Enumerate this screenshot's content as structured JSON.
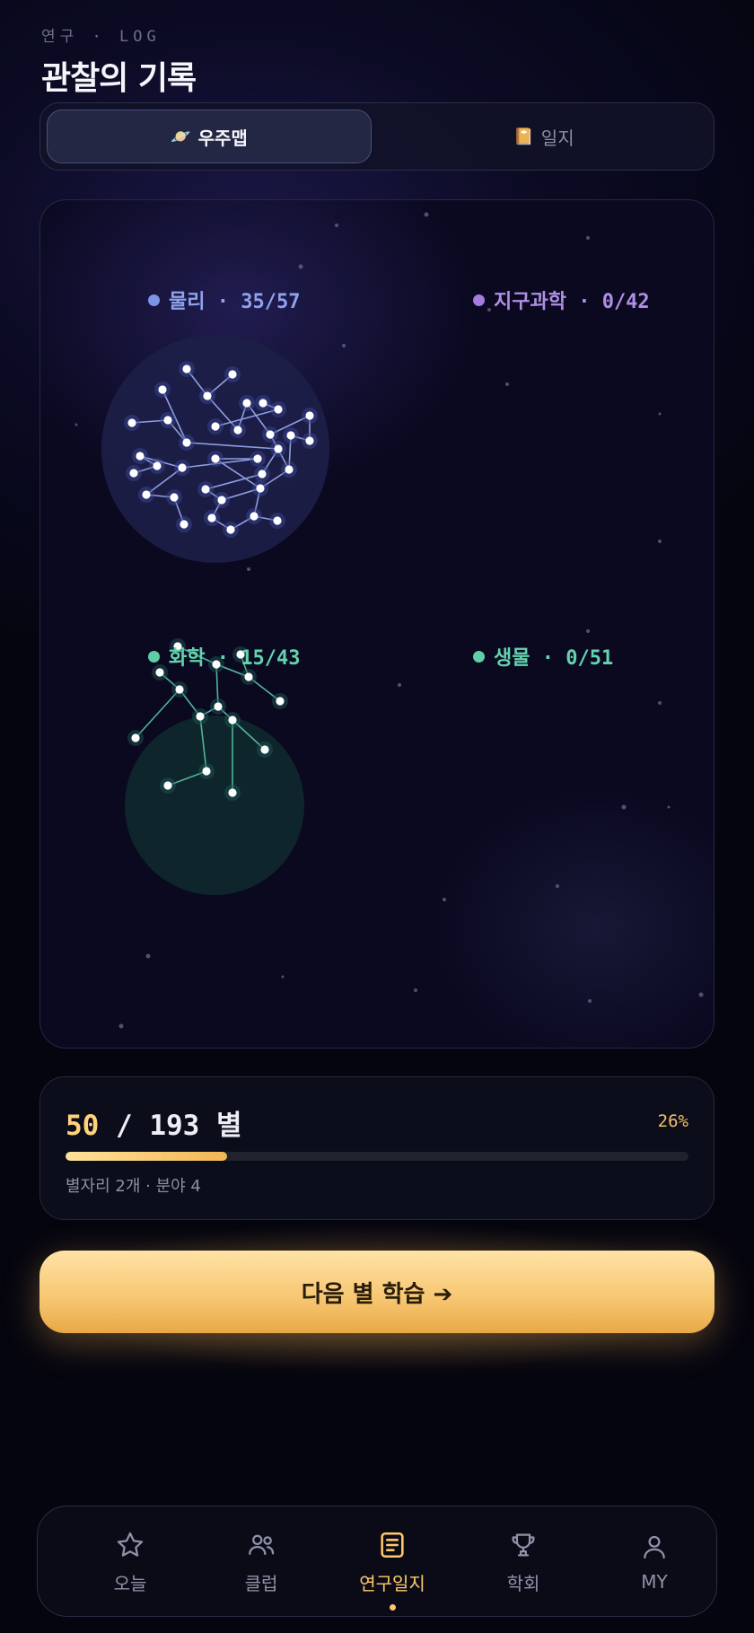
{
  "header": {
    "eyebrow": "연구 · LOG",
    "title": "관찰의 기록"
  },
  "segmented": {
    "tabs": [
      {
        "icon": "ringed-planet-icon",
        "glyph": "🪐",
        "label": "우주맵",
        "active": true
      },
      {
        "icon": "notebook-icon",
        "glyph": "📔",
        "label": "일지",
        "active": false
      }
    ]
  },
  "star_map": {
    "fields": [
      {
        "label": "물리 · 35/57",
        "name": "물리",
        "done": 35,
        "total": 57,
        "color": "#7c93e6"
      },
      {
        "label": "지구과학 · 0/42",
        "name": "지구과학",
        "done": 0,
        "total": 42,
        "color": "#a57be0"
      },
      {
        "label": "화학 · 15/43",
        "name": "화학",
        "done": 15,
        "total": 43,
        "color": "#5fcfa8"
      },
      {
        "label": "생물 · 0/51",
        "name": "생물",
        "done": 0,
        "total": 51,
        "color": "#5fcfa8"
      }
    ]
  },
  "progress": {
    "current": "50",
    "rest": " / 193 별",
    "percent_label": "26%",
    "fraction": 0.26,
    "meta": "별자리 2개 · 분야 4"
  },
  "cta": {
    "label": "다음 별 학습 ➔"
  },
  "bottom_nav": {
    "items": [
      {
        "label": "오늘",
        "icon": "star-icon",
        "active": false
      },
      {
        "label": "클럽",
        "icon": "users-icon",
        "active": false
      },
      {
        "label": "연구일지",
        "icon": "journal-icon",
        "active": true
      },
      {
        "label": "학회",
        "icon": "trophy-icon",
        "active": false
      },
      {
        "label": "MY",
        "icon": "person-icon",
        "active": false
      }
    ]
  },
  "colors": {
    "accent": "#ffc86a",
    "physics": "#7c93e6",
    "earth": "#a57be0",
    "chemistry": "#5fcfa8",
    "biology": "#5fcfa8"
  }
}
